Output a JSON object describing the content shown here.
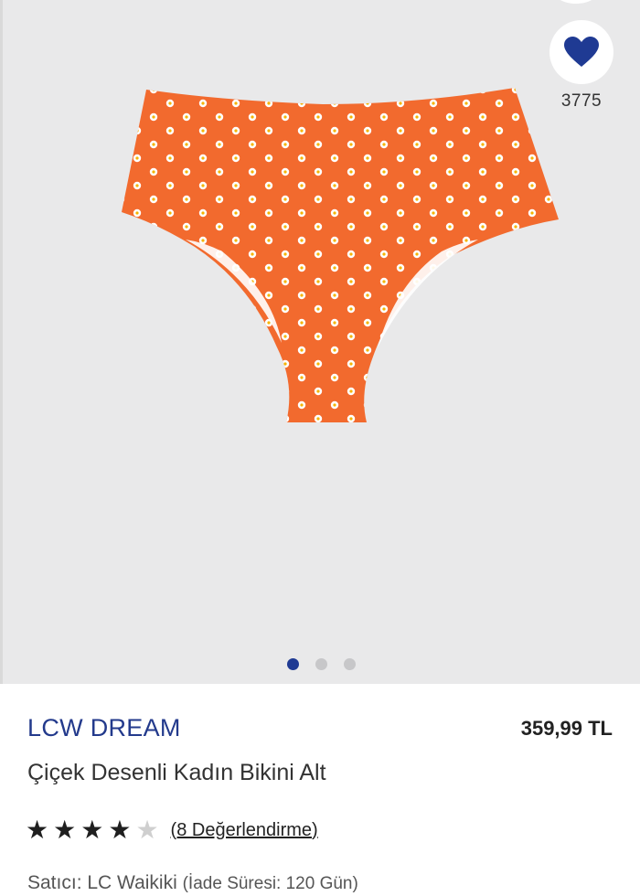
{
  "favorite": {
    "icon": "heart-icon",
    "count": "3775",
    "color": "#1f3a93"
  },
  "gallery": {
    "image": "orange-daisy-print-bikini-bottom",
    "slide_count": 3,
    "active_slide": 1,
    "active_dot_color": "#1f3a93"
  },
  "product": {
    "brand": "LCW DREAM",
    "price": "359,99 TL",
    "title": "Çiçek Desenli Kadın Bikini Alt",
    "rating": {
      "value": 4,
      "max": 5,
      "reviews_label": "(8 Değerlendirme)"
    },
    "seller_label": "Satıcı: ",
    "seller_name": "LC Waikiki",
    "return_info": "(İade Süresi: 120 Gün)",
    "brand_color": "#233a8c",
    "fabric_color": "#f26a2e"
  }
}
